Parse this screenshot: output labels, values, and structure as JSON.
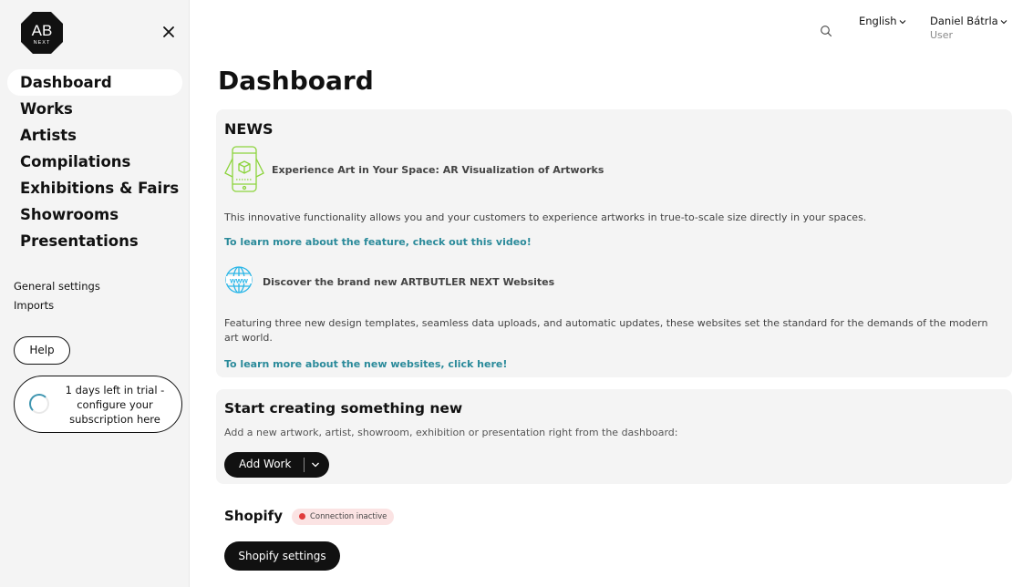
{
  "logo": {
    "main": "AB",
    "sub": "NEXT"
  },
  "sidebar": {
    "nav": [
      {
        "label": "Dashboard",
        "active": true
      },
      {
        "label": "Works",
        "active": false
      },
      {
        "label": "Artists",
        "active": false
      },
      {
        "label": "Compilations",
        "active": false
      },
      {
        "label": "Exhibitions & Fairs",
        "active": false
      },
      {
        "label": "Showrooms",
        "active": false
      },
      {
        "label": "Presentations",
        "active": false
      }
    ],
    "sub_links": [
      "General settings",
      "Imports"
    ],
    "help_label": "Help",
    "trial_text": "1 days left in trial - configure your subscription here"
  },
  "topbar": {
    "language": "English",
    "user_name": "Daniel Bátrla",
    "user_role": "User"
  },
  "page_title": "Dashboard",
  "news": {
    "title": "NEWS",
    "items": [
      {
        "icon": "ar-phone-icon",
        "heading": "Experience Art in Your Space: AR Visualization of Artworks",
        "body": "This innovative functionality allows you and your customers to experience artworks in true-to-scale size directly in your spaces.",
        "link": "To learn more about the feature, check out this video!"
      },
      {
        "icon": "www-globe-icon",
        "heading": "Discover the brand new ARTBUTLER NEXT Websites",
        "body": "Featuring three new design templates, seamless data uploads, and automatic updates, these websites set the standard for the demands of the modern art world.",
        "link": "To learn more about the new websites, click here!"
      }
    ]
  },
  "create": {
    "title": "Start creating something new",
    "description": "Add a new artwork, artist, showroom, exhibition or presentation right from the dashboard:",
    "button_label": "Add Work"
  },
  "shopify": {
    "title": "Shopify",
    "status": "Connection inactive",
    "button_label": "Shopify settings"
  },
  "colors": {
    "accent_link": "#2a8a9a",
    "status_error": "#e03b3b",
    "ar_icon": "#8cd43c",
    "globe_icon": "#29b6e8"
  }
}
